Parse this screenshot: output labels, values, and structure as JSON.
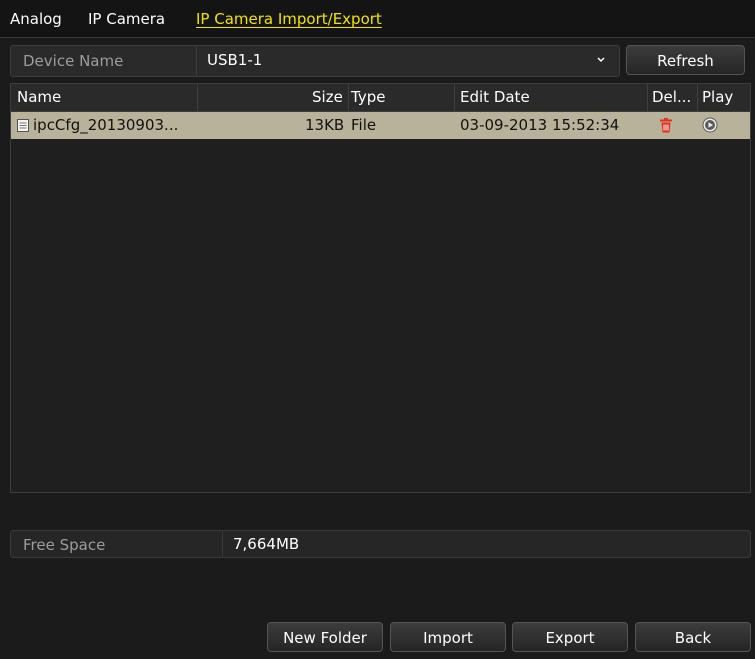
{
  "tabs": [
    {
      "label": "Analog",
      "active": false
    },
    {
      "label": "IP Camera",
      "active": false
    },
    {
      "label": "IP Camera Import/Export",
      "active": true
    }
  ],
  "device": {
    "label": "Device Name",
    "value": "USB1-1",
    "refresh_label": "Refresh"
  },
  "table": {
    "columns": [
      "Name",
      "Size",
      "Type",
      "Edit Date",
      "Del...",
      "Play"
    ],
    "rows": [
      {
        "name": "ipcCfg_20130903...",
        "size": "13KB",
        "type": "File",
        "edit_date": "03-09-2013 15:52:34",
        "delete_icon": "trash-icon",
        "play_icon": "play-circle-icon"
      }
    ]
  },
  "free_space": {
    "label": "Free Space",
    "value": "7,664MB"
  },
  "buttons": {
    "new_folder": "New Folder",
    "import": "Import",
    "export": "Export",
    "back": "Back"
  },
  "colors": {
    "active_tab": "#f3e300",
    "selected_row": "#b9b29a",
    "delete_icon": "#e0301e"
  }
}
